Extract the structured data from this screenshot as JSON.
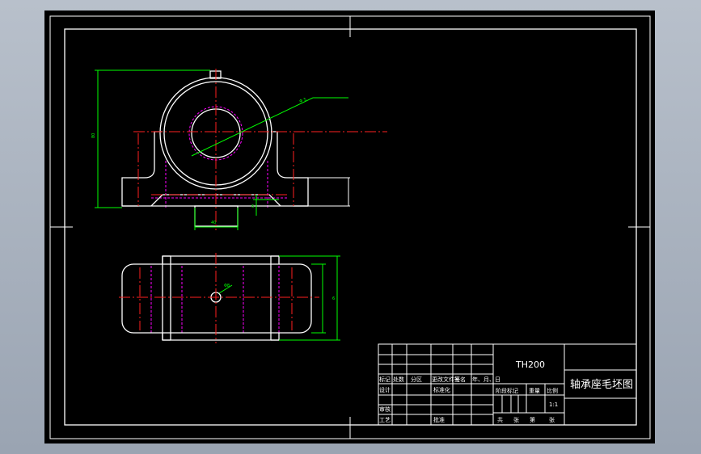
{
  "colors": {
    "background": "#000000",
    "outline": "#ffffff",
    "centerline": "#ff2020",
    "dimension": "#00ff00",
    "hidden": "#ff00ff",
    "workspace_frame": "#a9b2bf"
  },
  "drawing": {
    "dims": {
      "height_label": "80",
      "bore_label": "Φ 5",
      "base_width_label": "40",
      "slot_label": "6",
      "hole_label": "Φ8",
      "top_view_label": "6"
    }
  },
  "title_block": {
    "code": "TH200",
    "title": "轴承座毛坯图",
    "row_labels": [
      "标记",
      "处数",
      "分区",
      "更改文件号",
      "签名",
      "年、月、日"
    ],
    "design_label": "设计",
    "standardize_label": "标准化",
    "stage_label": "阶段标记",
    "weight_label": "重量",
    "scale_label": "比例",
    "scale_value": "1:1",
    "review_label": "审核",
    "process_label": "工艺",
    "approve_label": "批准",
    "sheets_total": "共",
    "sheet_unit1": "张",
    "sheet_no": "第",
    "sheet_unit2": "张"
  }
}
